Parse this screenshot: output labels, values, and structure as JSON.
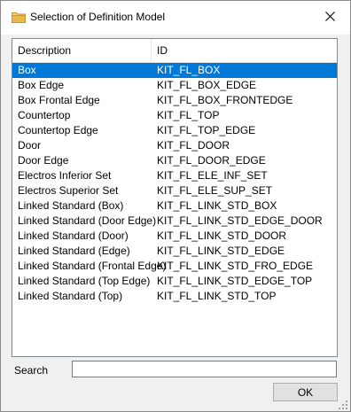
{
  "window": {
    "title": "Selection of Definition Model",
    "title_icon": "folder-icon",
    "close_icon": "close-icon"
  },
  "list": {
    "columns": {
      "description": "Description",
      "id": "ID"
    },
    "selected_index": 0,
    "rows": [
      {
        "description": "Box",
        "id": "KIT_FL_BOX"
      },
      {
        "description": "Box Edge",
        "id": "KIT_FL_BOX_EDGE"
      },
      {
        "description": "Box Frontal Edge",
        "id": "KIT_FL_BOX_FRONTEDGE"
      },
      {
        "description": "Countertop",
        "id": "KIT_FL_TOP"
      },
      {
        "description": "Countertop Edge",
        "id": "KIT_FL_TOP_EDGE"
      },
      {
        "description": "Door",
        "id": "KIT_FL_DOOR"
      },
      {
        "description": "Door Edge",
        "id": "KIT_FL_DOOR_EDGE"
      },
      {
        "description": "Electros Inferior Set",
        "id": "KIT_FL_ELE_INF_SET"
      },
      {
        "description": "Electros Superior Set",
        "id": "KIT_FL_ELE_SUP_SET"
      },
      {
        "description": "Linked Standard (Box)",
        "id": "KIT_FL_LINK_STD_BOX"
      },
      {
        "description": "Linked Standard (Door Edge)",
        "id": "KIT_FL_LINK_STD_EDGE_DOOR"
      },
      {
        "description": "Linked Standard (Door)",
        "id": "KIT_FL_LINK_STD_DOOR"
      },
      {
        "description": "Linked Standard (Edge)",
        "id": "KIT_FL_LINK_STD_EDGE"
      },
      {
        "description": "Linked Standard (Frontal Edge)",
        "id": "KIT_FL_LINK_STD_FRO_EDGE"
      },
      {
        "description": "Linked Standard (Top Edge)",
        "id": "KIT_FL_LINK_STD_EDGE_TOP"
      },
      {
        "description": "Linked Standard (Top)",
        "id": "KIT_FL_LINK_STD_TOP"
      }
    ]
  },
  "search": {
    "label": "Search",
    "value": "",
    "placeholder": ""
  },
  "buttons": {
    "ok_label": "OK"
  },
  "colors": {
    "selection": "#0078d7",
    "folder": "#e8b94a"
  }
}
